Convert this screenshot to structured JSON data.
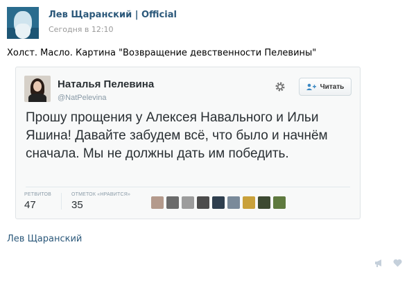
{
  "post": {
    "author": "Лев Щаранский | Official",
    "time": "Сегодня в 12:10",
    "text": "Холст. Масло. Картина \"Возвращение девственности Пелевины\""
  },
  "tweet": {
    "name": "Наталья Пелевина",
    "handle": "@NatPelevina",
    "follow_label": "Читать",
    "text": "Прошу прощения у Алексея Навального и Ильи Яшина! Давайте забудем всё, что было и начнём сначала. Мы не должны дать им победить.",
    "retweets_label": "РЕТВИТОВ",
    "retweets": "47",
    "likes_label": "ОТМЕТОК «НРАВИТСЯ»",
    "likes": "35",
    "liker_colors": [
      "#b49a8c",
      "#6b6b6b",
      "#9c9c9c",
      "#4c4c4c",
      "#2f3f4f",
      "#7a8a9a",
      "#c9a13b",
      "#3d4a32",
      "#5f7a3f"
    ]
  },
  "footer": {
    "author_link": "Лев Щаранский"
  },
  "icons": {
    "share": "megaphone-icon",
    "like": "heart-icon",
    "settings": "gear-icon",
    "follow": "person-add-icon"
  },
  "colors": {
    "vk_link": "#2b587a",
    "twitter_text": "#292f33",
    "muted": "#8899a6"
  }
}
